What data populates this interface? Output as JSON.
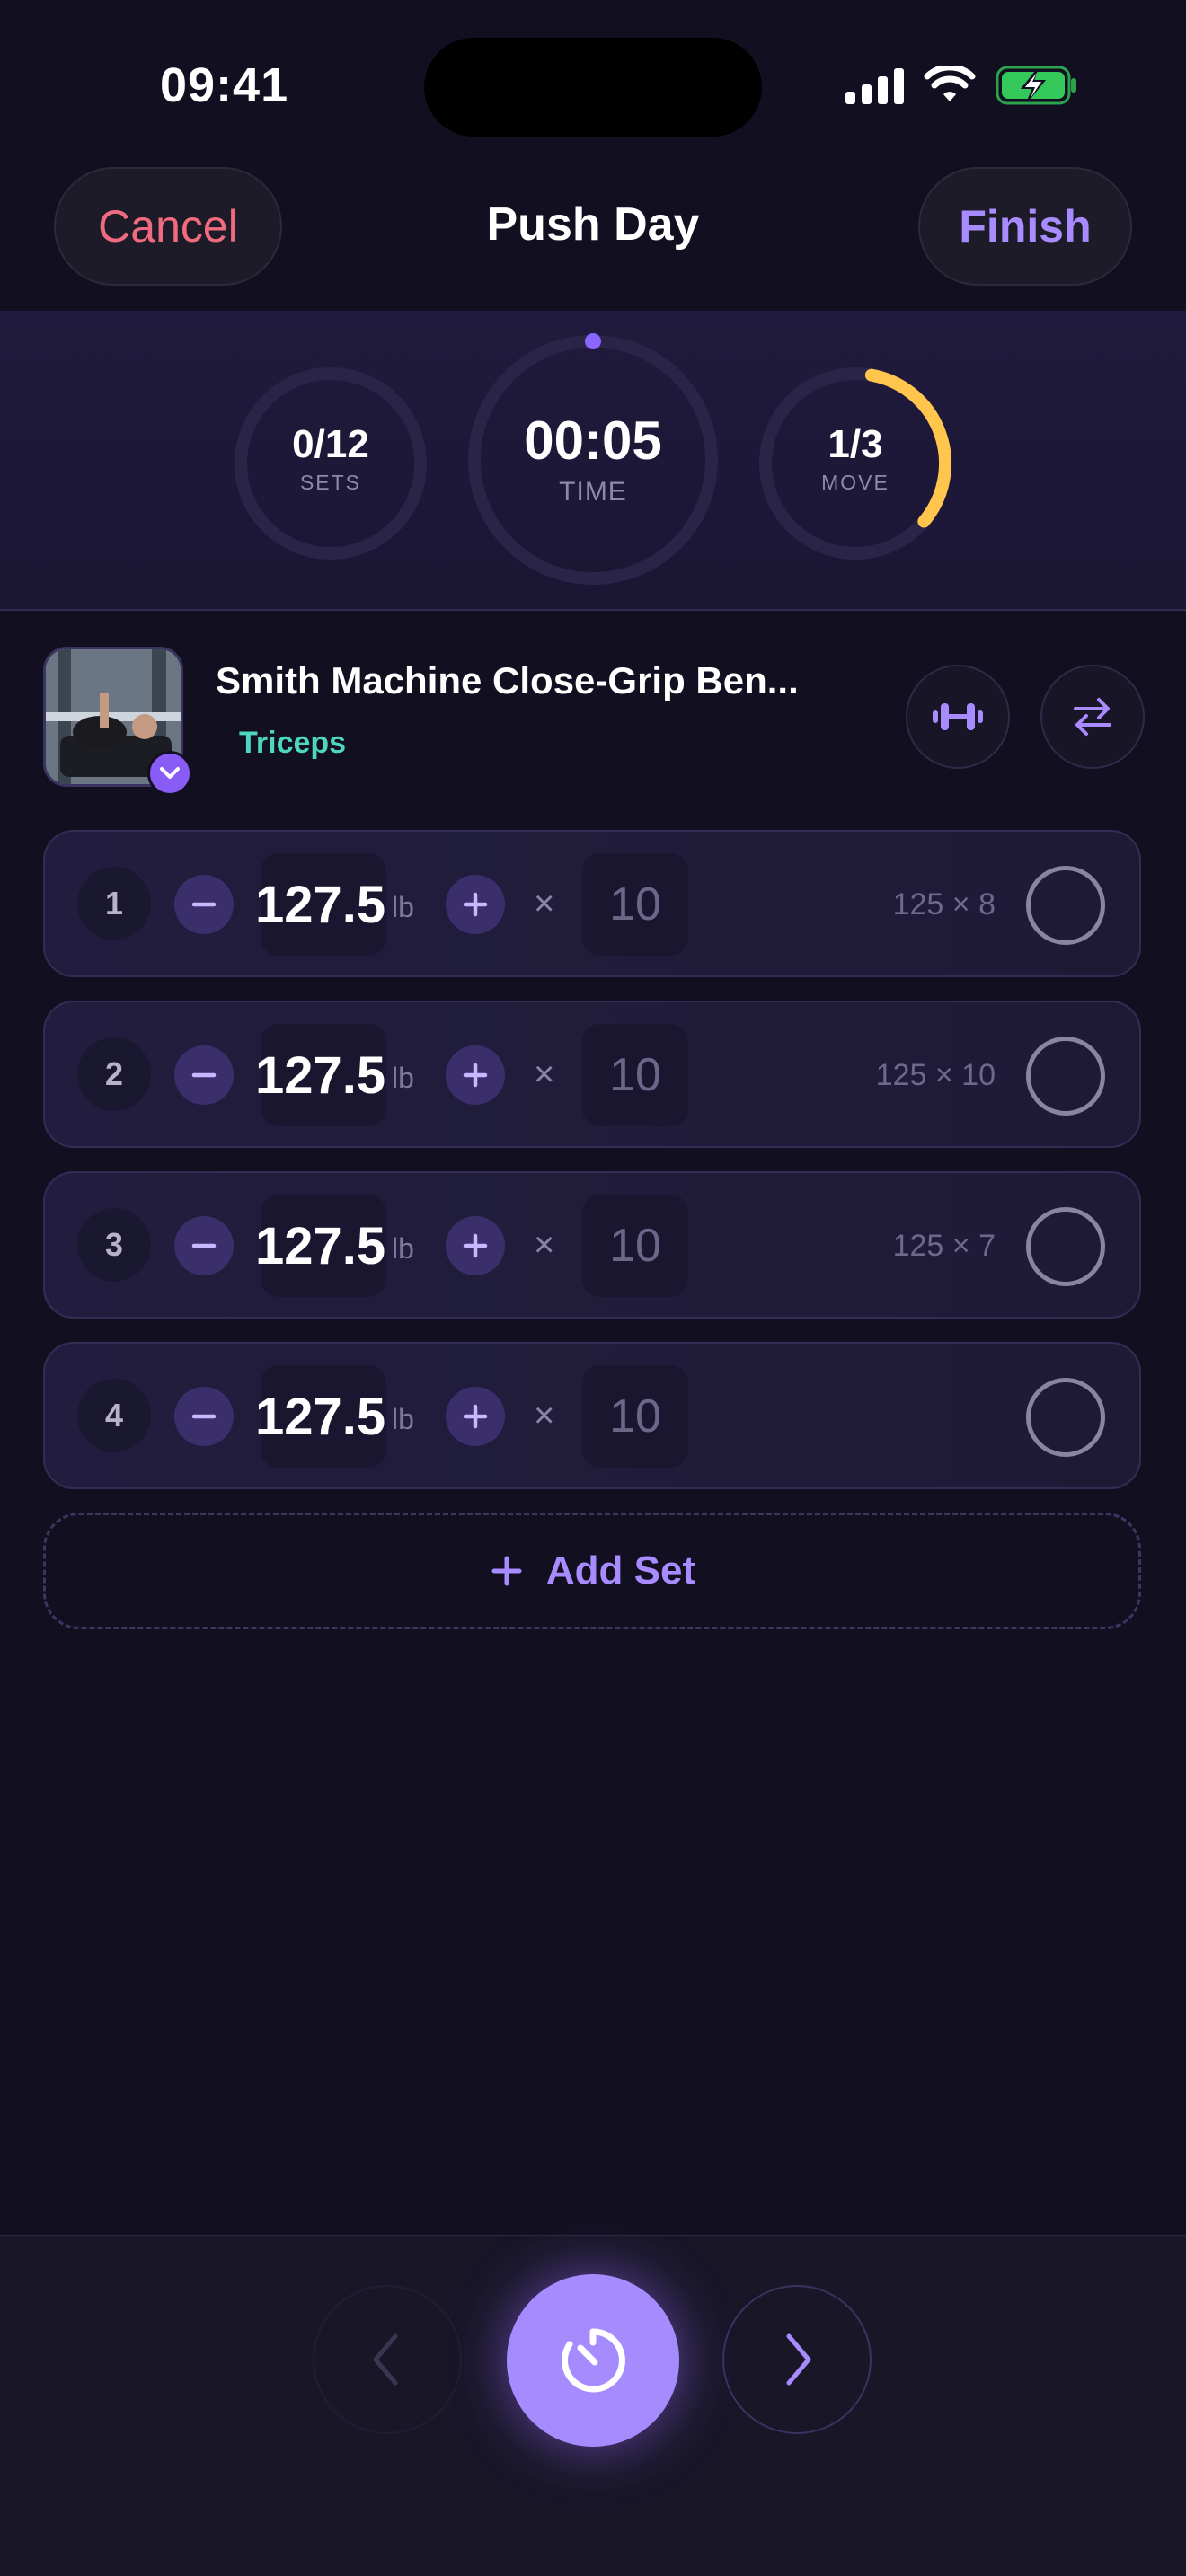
{
  "status_bar": {
    "time": "09:41"
  },
  "header": {
    "cancel_label": "Cancel",
    "title": "Push Day",
    "finish_label": "Finish"
  },
  "progress": {
    "sets": {
      "value": "0/12",
      "label": "SETS",
      "fraction": 0.0
    },
    "time": {
      "value": "00:05",
      "label": "TIME"
    },
    "move": {
      "value": "1/3",
      "label": "MOVE",
      "fraction": 0.333
    }
  },
  "exercise": {
    "name": "Smith Machine Close-Grip Ben...",
    "muscle": "Triceps",
    "icons": {
      "thumb_badge": "chevron-down-icon",
      "equipment": "dumbbell-icon",
      "swap": "swap-arrows-icon"
    }
  },
  "sets": [
    {
      "number": "1",
      "weight": "127.5",
      "unit": "lb",
      "times": "×",
      "reps": "10",
      "previous": "125 × 8"
    },
    {
      "number": "2",
      "weight": "127.5",
      "unit": "lb",
      "times": "×",
      "reps": "10",
      "previous": "125 × 10"
    },
    {
      "number": "3",
      "weight": "127.5",
      "unit": "lb",
      "times": "×",
      "reps": "10",
      "previous": "125 × 7"
    },
    {
      "number": "4",
      "weight": "127.5",
      "unit": "lb",
      "times": "×",
      "reps": "10",
      "previous": ""
    }
  ],
  "add_set_label": "Add Set",
  "bottom_nav": {
    "prev_icon": "chevron-left-icon",
    "timer_icon": "timer-icon",
    "next_icon": "chevron-right-icon"
  },
  "colors": {
    "accent": "#a88bff",
    "cancel": "#f06b7f",
    "muscle": "#4ed6c0",
    "move_ring": "#ffc54d",
    "battery": "#34c759"
  }
}
